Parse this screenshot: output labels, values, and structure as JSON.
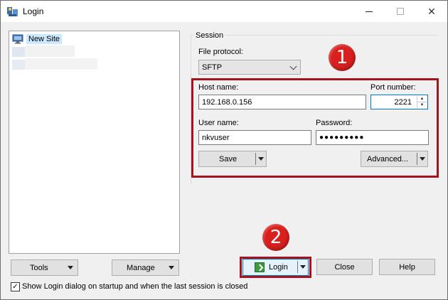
{
  "window": {
    "title": "Login"
  },
  "site_tree": {
    "items": [
      {
        "label": "New Site"
      }
    ]
  },
  "session": {
    "group_label": "Session",
    "file_protocol_label": "File protocol:",
    "file_protocol_value": "SFTP",
    "host_name_label": "Host name:",
    "host_name_value": "192.168.0.156",
    "port_label": "Port number:",
    "port_value": "2221",
    "user_name_label": "User name:",
    "user_name_value": "nkvuser",
    "password_label": "Password:",
    "password_dots": "●●●●●●●●●",
    "save_label": "Save",
    "advanced_label": "Advanced..."
  },
  "buttons": {
    "tools": "Tools",
    "manage": "Manage",
    "login": "Login",
    "close": "Close",
    "help": "Help"
  },
  "footer": {
    "checkbox_label": "Show Login dialog on startup and when the last session is closed",
    "checkbox_checked": "✓"
  },
  "annotations": {
    "badge_1": "1",
    "badge_2": "2"
  },
  "colors": {
    "highlight_red": "#a3141c",
    "badge_red": "#d9201e",
    "selection": "#cce8ff"
  }
}
